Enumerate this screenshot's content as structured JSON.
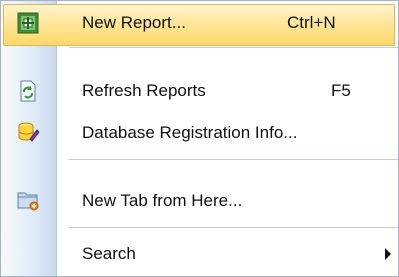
{
  "menu": {
    "items": [
      {
        "label": "New Report...",
        "shortcut": "Ctrl+N",
        "icon": "new-report-icon"
      },
      {
        "label": "Refresh Reports",
        "shortcut": "F5",
        "icon": "refresh-icon"
      },
      {
        "label": "Database Registration Info...",
        "shortcut": "",
        "icon": "database-registration-icon"
      },
      {
        "label": "New Tab from Here...",
        "shortcut": "",
        "icon": "new-tab-folder-icon"
      },
      {
        "label": "Search",
        "shortcut": "",
        "icon": ""
      }
    ]
  },
  "colors": {
    "highlight": "#ffe594",
    "gutter": "#dfeaf7",
    "border": "#a6b3c5"
  }
}
